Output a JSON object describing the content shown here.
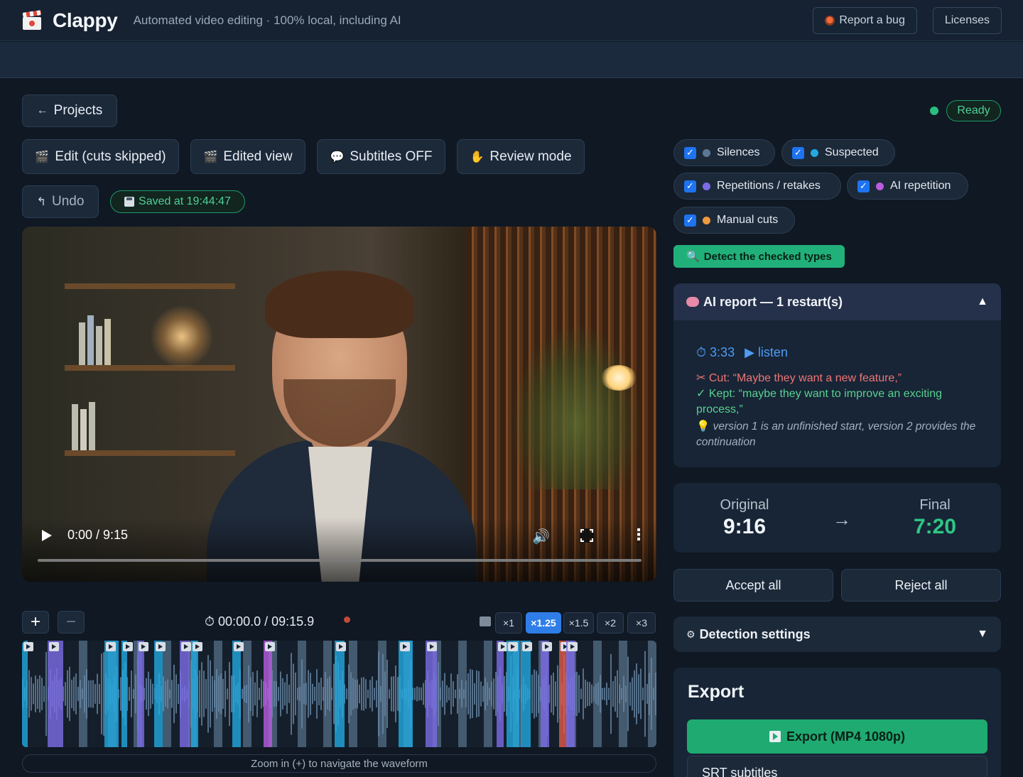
{
  "header": {
    "brand": "Clappy",
    "tagline": "Automated video editing · 100% local, including AI",
    "report_bug": "Report a bug",
    "licenses": "Licenses"
  },
  "nav": {
    "projects": "Projects"
  },
  "status": {
    "ready": "Ready"
  },
  "toolbar": {
    "edit": "Edit (cuts skipped)",
    "edited_view": "Edited view",
    "subtitles": "Subtitles OFF",
    "review": "Review mode",
    "undo": "Undo",
    "saved": "Saved at 19:44:47"
  },
  "video": {
    "time": "0:00 / 9:15",
    "progress": 0
  },
  "timeline": {
    "time": "00:00.0 / 09:15.9",
    "speeds": [
      "×1",
      "×1.25",
      "×1.5",
      "×2",
      "×3"
    ],
    "active_speed": "×1.25",
    "hint": "Zoom in (+) to navigate the waveform"
  },
  "filters": [
    {
      "label": "Silences",
      "checked": true,
      "color": "#5b7894"
    },
    {
      "label": "Suspected",
      "checked": true,
      "color": "#22a9e0"
    },
    {
      "label": "Repetitions / retakes",
      "checked": true,
      "color": "#7c6be6"
    },
    {
      "label": "AI repetition",
      "checked": true,
      "color": "#b85de0"
    },
    {
      "label": "Manual cuts",
      "checked": true,
      "color": "#f09a3e"
    }
  ],
  "detect_label": "Detect the checked types",
  "ai_report": {
    "title": "AI report — 1 restart(s)",
    "timestamp": "3:33",
    "listen": "listen",
    "cut": "Cut: “Maybe they want a new feature,”",
    "kept": "Kept: “maybe they want to improve an exciting process,”",
    "note": "version 1 is an unfinished start, version 2 provides the continuation"
  },
  "durations": {
    "original_label": "Original",
    "original": "9:16",
    "final_label": "Final",
    "final": "7:20"
  },
  "actions": {
    "accept": "Accept all",
    "reject": "Reject all"
  },
  "settings": {
    "title": "Detection settings"
  },
  "export": {
    "title": "Export",
    "mp4": "Export (MP4 1080p)",
    "srt": "SRT subtitles"
  },
  "colors": {
    "accent_green": "#22b07a",
    "accent_blue": "#2f7ee8",
    "silence": "#5b7894",
    "suspected": "#22a9e0",
    "repetition": "#7c6be6",
    "ai_repetition": "#b85de0",
    "manual": "#f09a3e"
  }
}
